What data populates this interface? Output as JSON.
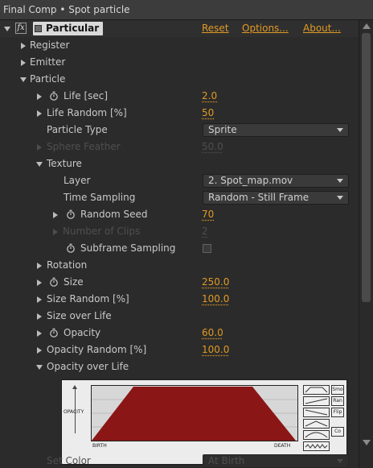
{
  "window": {
    "title": "Final Comp • Spot particle"
  },
  "effect": {
    "fx_label": "fx",
    "name": "Particular",
    "links": {
      "reset": "Reset",
      "options": "Options...",
      "about": "About..."
    }
  },
  "rows": {
    "register": "Register",
    "emitter": "Emitter",
    "particle": "Particle",
    "life": {
      "label": "Life [sec]",
      "value": "2.0"
    },
    "life_random": {
      "label": "Life Random [%]",
      "value": "50"
    },
    "particle_type": {
      "label": "Particle Type",
      "value": "Sprite"
    },
    "sphere_feather": {
      "label": "Sphere Feather",
      "value": "50.0"
    },
    "texture": "Texture",
    "layer": {
      "label": "Layer",
      "value": "2. Spot_map.mov"
    },
    "time_sampling": {
      "label": "Time Sampling",
      "value": "Random - Still Frame"
    },
    "random_seed": {
      "label": "Random Seed",
      "value": "70"
    },
    "number_of_clips": {
      "label": "Number of Clips",
      "value": "2"
    },
    "subframe_sampling": {
      "label": "Subframe Sampling",
      "checked": false
    },
    "rotation": "Rotation",
    "size": {
      "label": "Size",
      "value": "250.0"
    },
    "size_random": {
      "label": "Size Random [%]",
      "value": "100.0"
    },
    "size_over_life": "Size over Life",
    "opacity": {
      "label": "Opacity",
      "value": "60.0"
    },
    "opacity_random": {
      "label": "Opacity Random [%]",
      "value": "100.0"
    },
    "opacity_over_life": "Opacity over Life",
    "set_color": {
      "label": "Set Color",
      "value": "At Birth"
    }
  },
  "graph": {
    "ylabel": "OPACITY",
    "x_start": "BIRTH",
    "x_end": "DEATH",
    "buttons": [
      "Smo",
      "Ran",
      "Flip",
      "Co"
    ],
    "fill_color": "#8b1616"
  },
  "colors": {
    "accent": "#e09a25",
    "background": "#2b2b2b",
    "text": "#c9c9c9",
    "disabled": "#4f4f4f"
  }
}
